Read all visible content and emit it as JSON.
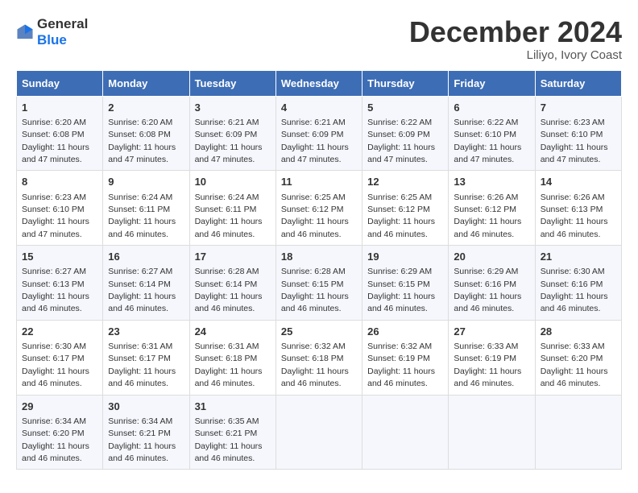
{
  "header": {
    "logo_general": "General",
    "logo_blue": "Blue",
    "title": "December 2024",
    "location": "Liliyo, Ivory Coast"
  },
  "weekdays": [
    "Sunday",
    "Monday",
    "Tuesday",
    "Wednesday",
    "Thursday",
    "Friday",
    "Saturday"
  ],
  "weeks": [
    [
      {
        "day": "1",
        "info": "Sunrise: 6:20 AM\nSunset: 6:08 PM\nDaylight: 11 hours\nand 47 minutes."
      },
      {
        "day": "2",
        "info": "Sunrise: 6:20 AM\nSunset: 6:08 PM\nDaylight: 11 hours\nand 47 minutes."
      },
      {
        "day": "3",
        "info": "Sunrise: 6:21 AM\nSunset: 6:09 PM\nDaylight: 11 hours\nand 47 minutes."
      },
      {
        "day": "4",
        "info": "Sunrise: 6:21 AM\nSunset: 6:09 PM\nDaylight: 11 hours\nand 47 minutes."
      },
      {
        "day": "5",
        "info": "Sunrise: 6:22 AM\nSunset: 6:09 PM\nDaylight: 11 hours\nand 47 minutes."
      },
      {
        "day": "6",
        "info": "Sunrise: 6:22 AM\nSunset: 6:10 PM\nDaylight: 11 hours\nand 47 minutes."
      },
      {
        "day": "7",
        "info": "Sunrise: 6:23 AM\nSunset: 6:10 PM\nDaylight: 11 hours\nand 47 minutes."
      }
    ],
    [
      {
        "day": "8",
        "info": "Sunrise: 6:23 AM\nSunset: 6:10 PM\nDaylight: 11 hours\nand 47 minutes."
      },
      {
        "day": "9",
        "info": "Sunrise: 6:24 AM\nSunset: 6:11 PM\nDaylight: 11 hours\nand 46 minutes."
      },
      {
        "day": "10",
        "info": "Sunrise: 6:24 AM\nSunset: 6:11 PM\nDaylight: 11 hours\nand 46 minutes."
      },
      {
        "day": "11",
        "info": "Sunrise: 6:25 AM\nSunset: 6:12 PM\nDaylight: 11 hours\nand 46 minutes."
      },
      {
        "day": "12",
        "info": "Sunrise: 6:25 AM\nSunset: 6:12 PM\nDaylight: 11 hours\nand 46 minutes."
      },
      {
        "day": "13",
        "info": "Sunrise: 6:26 AM\nSunset: 6:12 PM\nDaylight: 11 hours\nand 46 minutes."
      },
      {
        "day": "14",
        "info": "Sunrise: 6:26 AM\nSunset: 6:13 PM\nDaylight: 11 hours\nand 46 minutes."
      }
    ],
    [
      {
        "day": "15",
        "info": "Sunrise: 6:27 AM\nSunset: 6:13 PM\nDaylight: 11 hours\nand 46 minutes."
      },
      {
        "day": "16",
        "info": "Sunrise: 6:27 AM\nSunset: 6:14 PM\nDaylight: 11 hours\nand 46 minutes."
      },
      {
        "day": "17",
        "info": "Sunrise: 6:28 AM\nSunset: 6:14 PM\nDaylight: 11 hours\nand 46 minutes."
      },
      {
        "day": "18",
        "info": "Sunrise: 6:28 AM\nSunset: 6:15 PM\nDaylight: 11 hours\nand 46 minutes."
      },
      {
        "day": "19",
        "info": "Sunrise: 6:29 AM\nSunset: 6:15 PM\nDaylight: 11 hours\nand 46 minutes."
      },
      {
        "day": "20",
        "info": "Sunrise: 6:29 AM\nSunset: 6:16 PM\nDaylight: 11 hours\nand 46 minutes."
      },
      {
        "day": "21",
        "info": "Sunrise: 6:30 AM\nSunset: 6:16 PM\nDaylight: 11 hours\nand 46 minutes."
      }
    ],
    [
      {
        "day": "22",
        "info": "Sunrise: 6:30 AM\nSunset: 6:17 PM\nDaylight: 11 hours\nand 46 minutes."
      },
      {
        "day": "23",
        "info": "Sunrise: 6:31 AM\nSunset: 6:17 PM\nDaylight: 11 hours\nand 46 minutes."
      },
      {
        "day": "24",
        "info": "Sunrise: 6:31 AM\nSunset: 6:18 PM\nDaylight: 11 hours\nand 46 minutes."
      },
      {
        "day": "25",
        "info": "Sunrise: 6:32 AM\nSunset: 6:18 PM\nDaylight: 11 hours\nand 46 minutes."
      },
      {
        "day": "26",
        "info": "Sunrise: 6:32 AM\nSunset: 6:19 PM\nDaylight: 11 hours\nand 46 minutes."
      },
      {
        "day": "27",
        "info": "Sunrise: 6:33 AM\nSunset: 6:19 PM\nDaylight: 11 hours\nand 46 minutes."
      },
      {
        "day": "28",
        "info": "Sunrise: 6:33 AM\nSunset: 6:20 PM\nDaylight: 11 hours\nand 46 minutes."
      }
    ],
    [
      {
        "day": "29",
        "info": "Sunrise: 6:34 AM\nSunset: 6:20 PM\nDaylight: 11 hours\nand 46 minutes."
      },
      {
        "day": "30",
        "info": "Sunrise: 6:34 AM\nSunset: 6:21 PM\nDaylight: 11 hours\nand 46 minutes."
      },
      {
        "day": "31",
        "info": "Sunrise: 6:35 AM\nSunset: 6:21 PM\nDaylight: 11 hours\nand 46 minutes."
      },
      null,
      null,
      null,
      null
    ]
  ]
}
